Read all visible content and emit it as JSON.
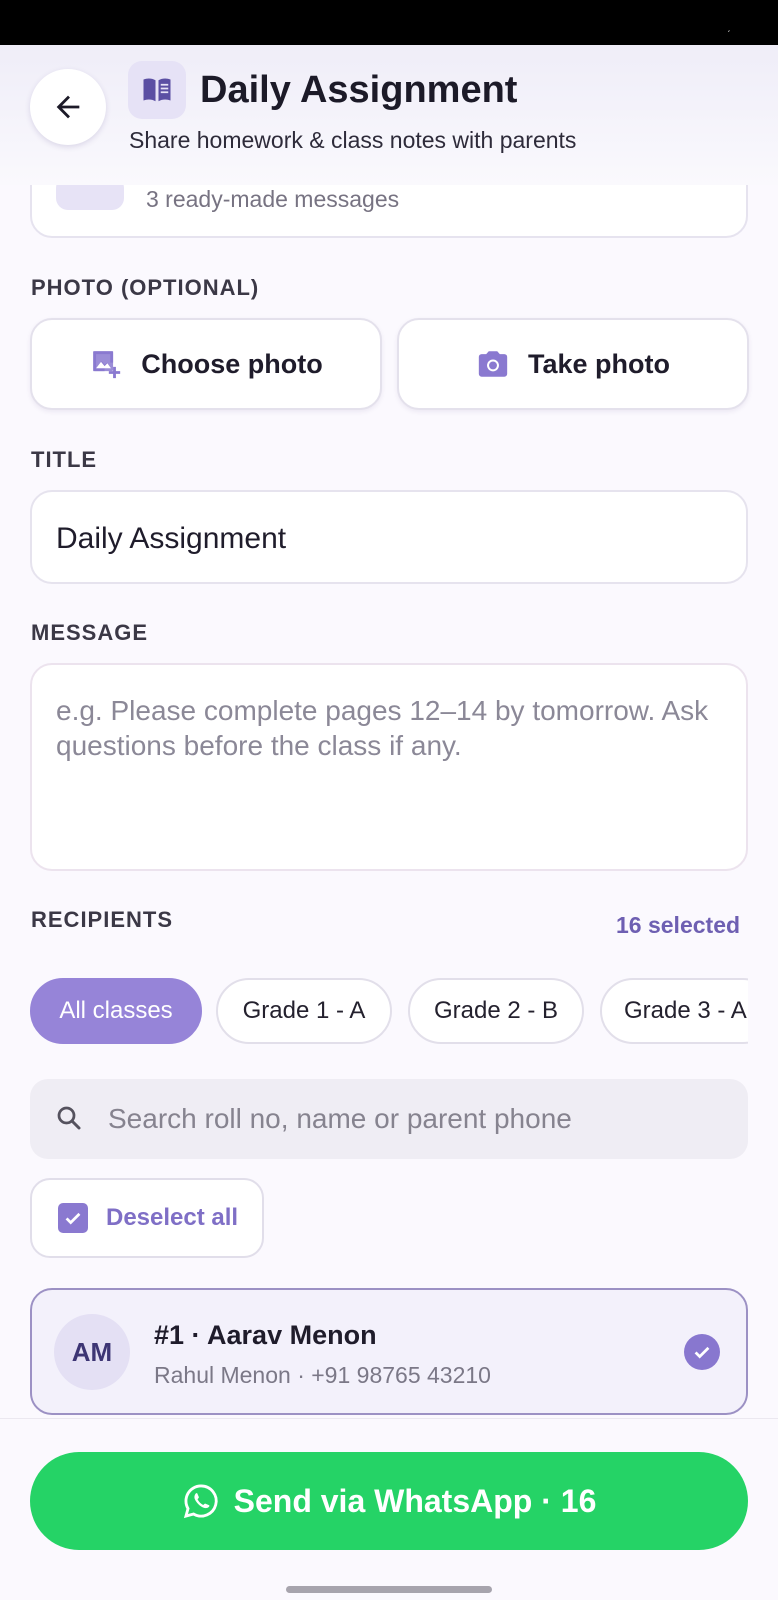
{
  "header": {
    "title": "Daily Assignment",
    "subtitle": "Share homework & class notes with parents"
  },
  "templates": {
    "subtitle": "3 ready-made messages"
  },
  "photo": {
    "label": "PHOTO (OPTIONAL)",
    "choose_label": "Choose photo",
    "take_label": "Take photo"
  },
  "title_field": {
    "label": "TITLE",
    "value": "Daily Assignment"
  },
  "message_field": {
    "label": "MESSAGE",
    "placeholder": "e.g. Please complete pages 12–14 by tomorrow. Ask questions before the class if any."
  },
  "recipients": {
    "label": "RECIPIENTS",
    "selected_count": "16 selected",
    "chips": [
      {
        "label": "All classes",
        "active": true
      },
      {
        "label": "Grade 1 - A",
        "active": false
      },
      {
        "label": "Grade 2 - B",
        "active": false
      },
      {
        "label": "Grade 3 - A",
        "active": false
      }
    ],
    "search_placeholder": "Search roll no, name or parent phone",
    "deselect_label": "Deselect all",
    "students": [
      {
        "initials": "AM",
        "name": "#1 · Aarav Menon",
        "parent": "Rahul Menon · +91 98765 43210",
        "selected": true
      }
    ]
  },
  "send": {
    "label": "Send via WhatsApp · 16"
  },
  "colors": {
    "accent": "#8a79d0",
    "whatsapp": "#25d366",
    "text": "#1f1c2b"
  }
}
